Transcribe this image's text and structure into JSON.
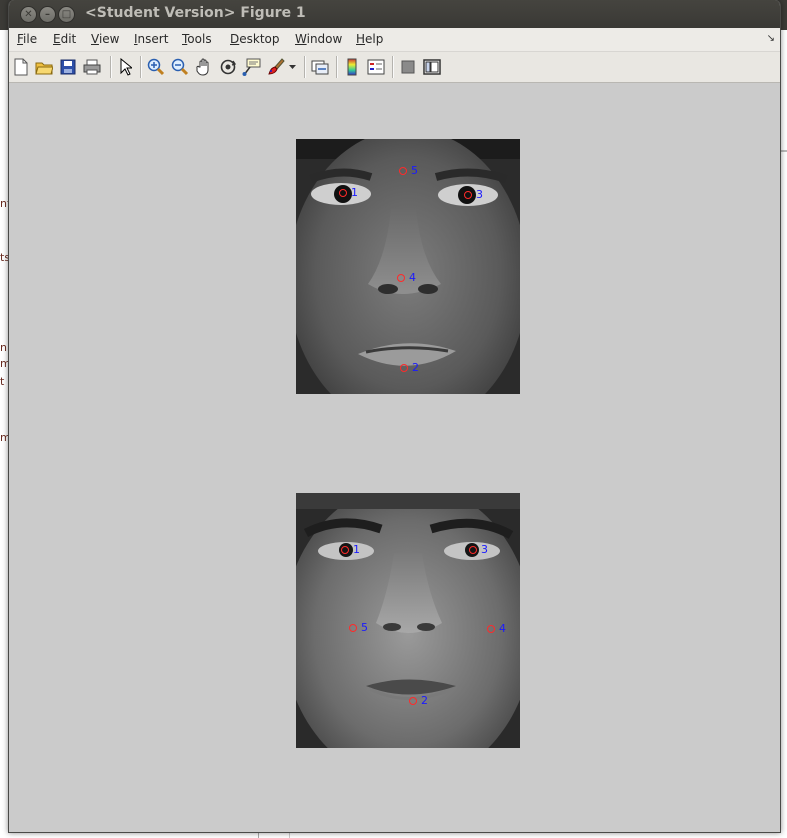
{
  "window": {
    "title": "<Student Version> Figure 1"
  },
  "window_buttons": [
    "close",
    "minimize",
    "maximize"
  ],
  "menu": [
    {
      "label": "File",
      "underline": "F",
      "rest": "ile"
    },
    {
      "label": "Edit",
      "underline": "E",
      "rest": "dit"
    },
    {
      "label": "View",
      "underline": "V",
      "rest": "iew"
    },
    {
      "label": "Insert",
      "underline": "I",
      "rest": "nsert"
    },
    {
      "label": "Tools",
      "underline": "T",
      "rest": "ools"
    },
    {
      "label": "Desktop",
      "underline": "D",
      "rest": "esktop"
    },
    {
      "label": "Window",
      "underline": "W",
      "rest": "indow"
    },
    {
      "label": "Help",
      "underline": "H",
      "rest": "elp"
    }
  ],
  "toolbar": [
    "new-figure-icon",
    "open-file-icon",
    "save-icon",
    "print-icon",
    "pointer-icon",
    "zoom-in-icon",
    "zoom-out-icon",
    "pan-icon",
    "rotate-3d-icon",
    "data-cursor-icon",
    "brush-icon",
    "brush-dropdown-icon",
    "link-plot-icon",
    "insert-colorbar-icon",
    "insert-legend-icon",
    "hide-plot-tools-icon",
    "show-plot-tools-icon"
  ],
  "background_app_text": [
    "nt",
    "ts",
    "n",
    "m",
    "t",
    "m"
  ],
  "faces": [
    {
      "name": "face-top",
      "landmarks": [
        {
          "label": "1"
        },
        {
          "label": "3"
        },
        {
          "label": "5"
        },
        {
          "label": "4"
        },
        {
          "label": "2"
        }
      ]
    },
    {
      "name": "face-bottom",
      "landmarks": [
        {
          "label": "1"
        },
        {
          "label": "3"
        },
        {
          "label": "5"
        },
        {
          "label": "4"
        },
        {
          "label": "2"
        }
      ]
    }
  ],
  "colors": {
    "marker": "#ff2a2a",
    "label": "#1a1aff",
    "canvas": "#cbcbcb"
  }
}
